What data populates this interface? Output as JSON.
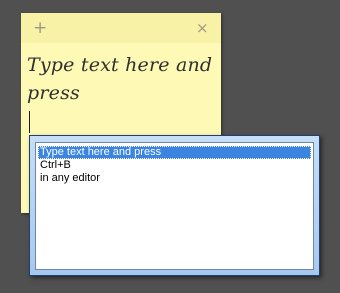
{
  "note": {
    "add_icon": "plus-icon",
    "add_glyph": "+",
    "close_icon": "close-icon",
    "close_glyph": "×",
    "text_line1": "Type text here and",
    "text_line2": "press",
    "background_color": "#FEF9B4"
  },
  "popup": {
    "items": [
      {
        "label": "Type text here and press",
        "selected": true
      },
      {
        "label": "Ctrl+B",
        "selected": false
      },
      {
        "label": "in any editor",
        "selected": false
      }
    ],
    "selection_color": "#3B84E0",
    "frame_color": "#A7C8EE"
  }
}
